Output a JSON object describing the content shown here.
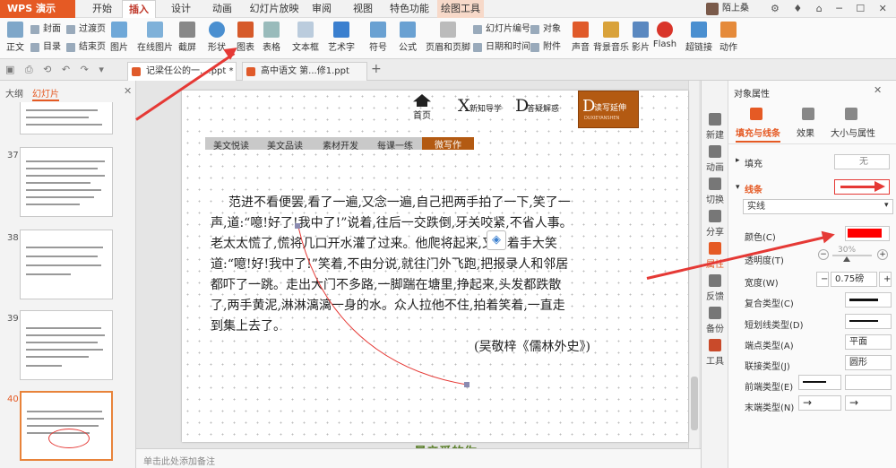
{
  "app": {
    "name": "WPS 演示"
  },
  "menu": {
    "tabs": [
      "开始",
      "插入",
      "设计",
      "动画",
      "幻灯片放映",
      "审阅",
      "视图",
      "特色功能",
      "绘图工具"
    ],
    "active": "插入",
    "user": "陌上桑"
  },
  "ribbon": {
    "group1": [
      {
        "label": "正文"
      },
      {
        "label": "封面"
      },
      {
        "label": "目录"
      },
      {
        "label": "过渡页"
      },
      {
        "label": "结束页"
      }
    ],
    "buttons": [
      "图片",
      "在线图片",
      "截屏",
      "形状",
      "图表",
      "表格",
      "文本框",
      "艺术字",
      "符号",
      "公式",
      "页眉和页脚",
      "幻灯片编号",
      "日期和时间",
      "对象",
      "附件",
      "声音",
      "背景音乐",
      "影片",
      "Flash",
      "超链接",
      "动作"
    ]
  },
  "doc_tabs": [
    {
      "label": "记梁任公的一....ppt *"
    },
    {
      "label": "高中语文 第...修1.ppt"
    }
  ],
  "left_panel": {
    "tabs": [
      "大纲",
      "幻灯片"
    ],
    "slide_numbers": [
      "37",
      "38",
      "39",
      "40"
    ]
  },
  "slide": {
    "nav": {
      "home": "首页",
      "x": "新知导学",
      "d": "答疑解惑",
      "d2": "读写延伸",
      "d2_sub": "DUXIEYANSHEN"
    },
    "subtabs": [
      "美文悦读",
      "美文品读",
      "素材开发",
      "每课一练",
      "微写作"
    ],
    "body_lines": [
      "范进不看便罢,看了一遍,又念一遍,自己把两手拍了一下,笑了一",
      "声,道:“噫!好了!我中了!”说着,往后一交跌倒,牙关咬紧,不省人事。",
      "老太太慌了,慌将几口开水灌了过来。他爬将起来,又拍着手大笑",
      "道:“噫!好!我中了!”笑着,不由分说,就往门外飞跑,把报录人和邻居",
      "都吓了一跳。走出大门不多路,一脚踹在塘里,挣起来,头发都跌散",
      "了,两手黄泥,淋淋漓漓一身的水。众人拉他不住,拍着笑着,一直走",
      "到集上去了。"
    ],
    "source": "(吴敬梓《儒林外史》)",
    "footer": "最亲爱的你"
  },
  "notes_placeholder": "单击此处添加备注",
  "side_strip": [
    "新建",
    "动画",
    "切换",
    "分享",
    "属性",
    "反馈",
    "备份",
    "工具"
  ],
  "properties": {
    "title": "对象属性",
    "tabs": [
      "填充与线条",
      "效果",
      "大小与属性"
    ],
    "fill_label": "填充",
    "fill_value": "无",
    "line_label": "线条",
    "line_type": "实线",
    "color_label": "颜色(C)",
    "color": "#ff0000",
    "transparency_label": "透明度(T)",
    "transparency": "30%",
    "width_label": "宽度(W)",
    "width": "0.75磅",
    "compound_label": "复合类型(C)",
    "dash_label": "短划线类型(D)",
    "cap_label": "端点类型(A)",
    "cap_value": "平面",
    "join_label": "联接类型(J)",
    "join_value": "圆形",
    "begin_label": "前端类型(E)",
    "end_label": "末端类型(N)"
  },
  "colors": {
    "accent": "#e55a24",
    "brown": "#b35a12",
    "red": "#e53935"
  }
}
